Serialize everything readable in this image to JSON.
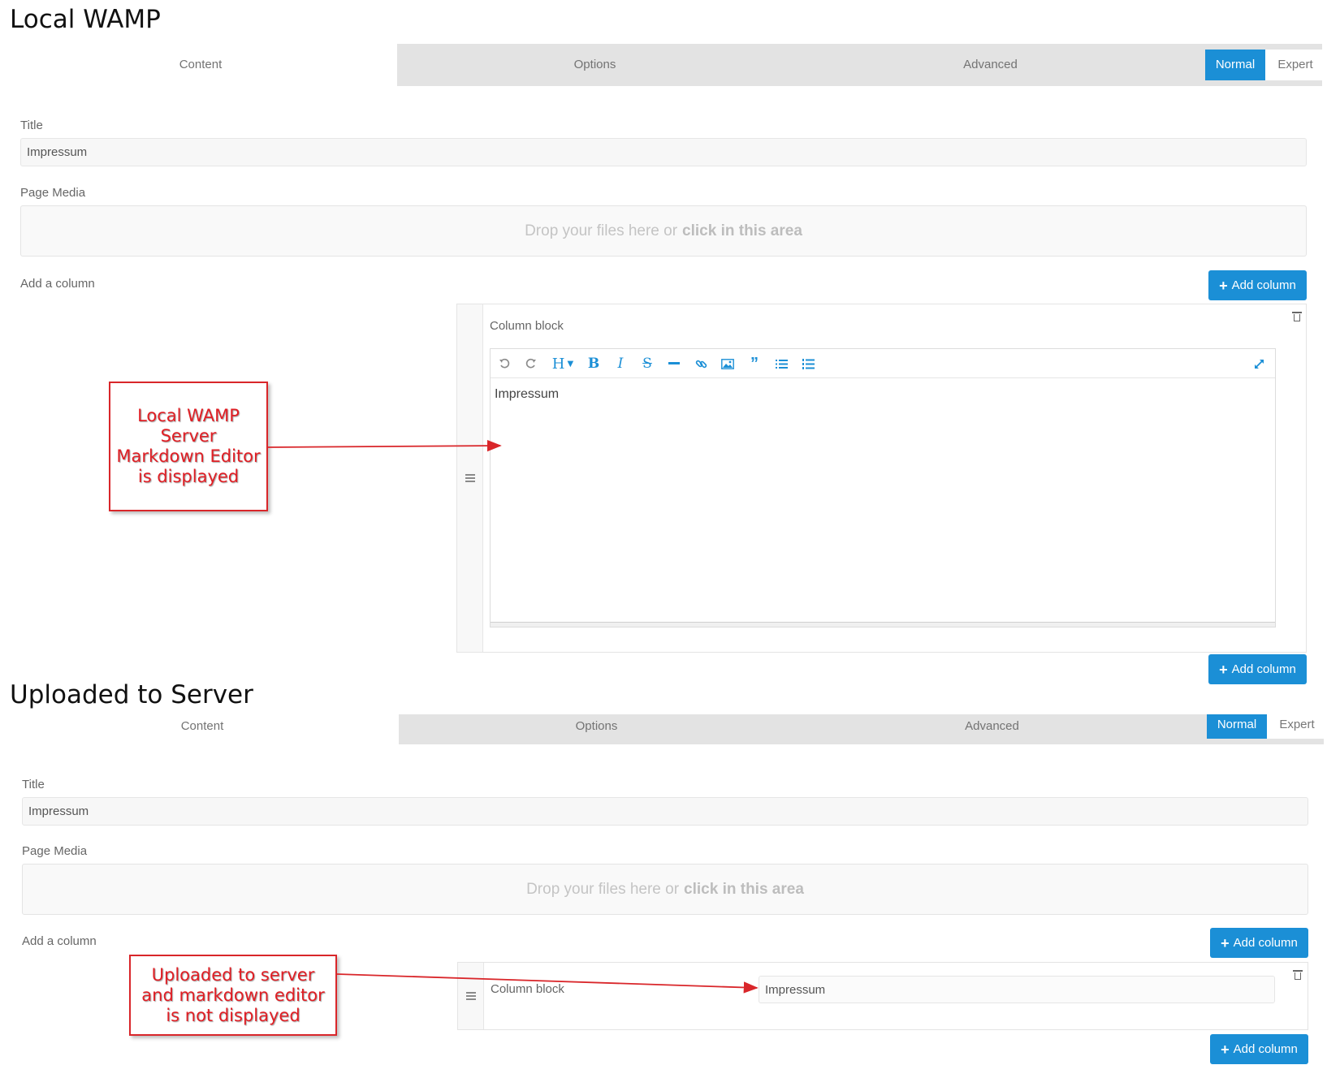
{
  "top": {
    "heading": "Local WAMP",
    "tabs": [
      "Content",
      "Options",
      "Advanced"
    ],
    "mode": {
      "normal": "Normal",
      "expert": "Expert"
    },
    "title_label": "Title",
    "title_value": "Impressum",
    "media_label": "Page Media",
    "dropzone": {
      "text": "Drop your files here or",
      "emphasis": "click in this area"
    },
    "add_column_label": "Add a column",
    "add_button": "Add column",
    "column_block_label": "Column block",
    "editor_content": "Impressum",
    "callout": "Local WAMP Server Markdown Editor is displayed"
  },
  "bottom": {
    "heading": "Uploaded to Server",
    "tabs": [
      "Content",
      "Options",
      "Advanced"
    ],
    "mode": {
      "normal": "Normal",
      "expert": "Expert"
    },
    "title_label": "Title",
    "title_value": "Impressum",
    "media_label": "Page Media",
    "dropzone": {
      "text": "Drop your files here or",
      "emphasis": "click in this area"
    },
    "add_column_label": "Add a column",
    "add_button": "Add column",
    "column_block_label": "Column block",
    "column_value": "Impressum",
    "callout": "Uploaded to server and markdown editor is not displayed"
  },
  "toolbar_icons": [
    "undo-icon",
    "redo-icon",
    "heading-icon",
    "bold-icon",
    "italic-icon",
    "strikethrough-icon",
    "horizontal-rule-icon",
    "link-icon",
    "image-icon",
    "quote-icon",
    "bullet-list-icon",
    "numbered-list-icon",
    "fullscreen-icon"
  ],
  "colors": {
    "accent": "#1b8fd6",
    "callout_red": "#e01e24",
    "tab_bg": "#e3e3e3"
  }
}
